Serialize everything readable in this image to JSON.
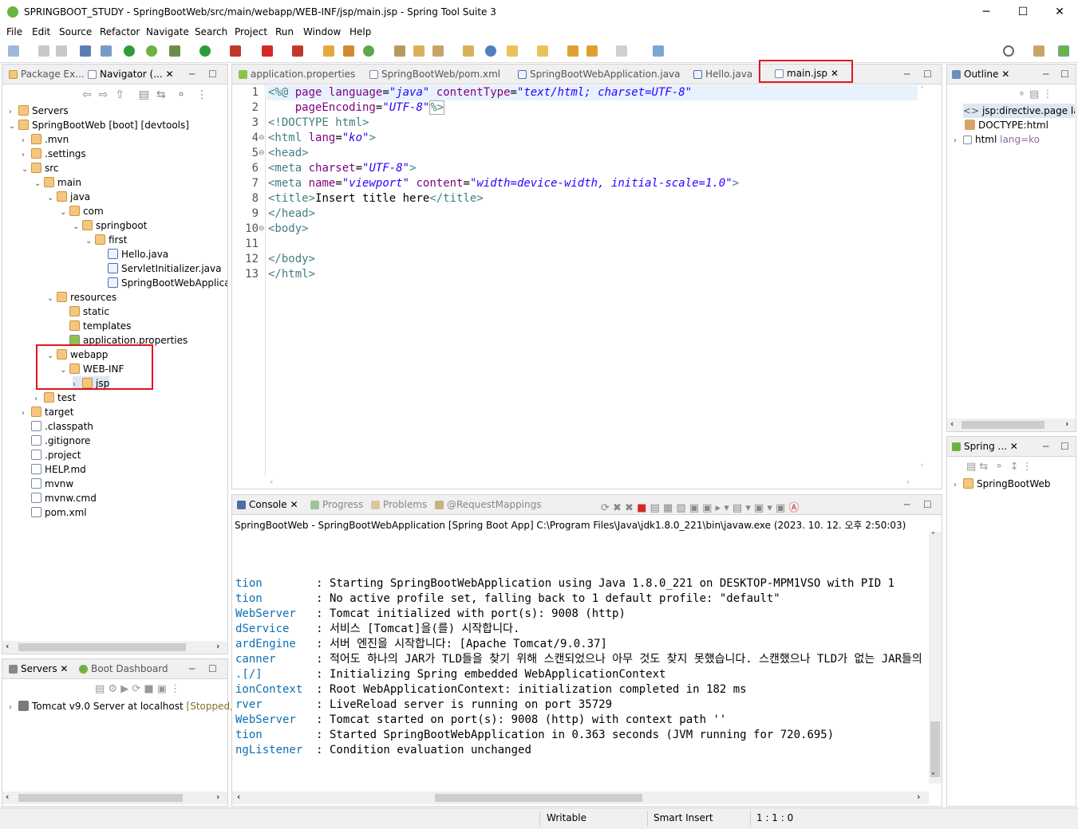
{
  "window": {
    "title": "SPRINGBOOT_STUDY - SpringBootWeb/src/main/webapp/WEB-INF/jsp/main.jsp - Spring Tool Suite 3"
  },
  "menu": [
    "File",
    "Edit",
    "Source",
    "Refactor",
    "Navigate",
    "Search",
    "Project",
    "Run",
    "Window",
    "Help"
  ],
  "left_panel": {
    "tabs": [
      "Package Ex...",
      "Navigator (..."
    ],
    "tree": [
      {
        "label": "Servers",
        "depth": 0,
        "arrow": "›",
        "icon": "folder"
      },
      {
        "label": "SpringBootWeb [boot] [devtools]",
        "depth": 0,
        "arrow": "⌄",
        "icon": "project"
      },
      {
        "label": ".mvn",
        "depth": 1,
        "arrow": "›",
        "icon": "folder"
      },
      {
        "label": ".settings",
        "depth": 1,
        "arrow": "›",
        "icon": "folder"
      },
      {
        "label": "src",
        "depth": 1,
        "arrow": "⌄",
        "icon": "folder"
      },
      {
        "label": "main",
        "depth": 2,
        "arrow": "⌄",
        "icon": "folder"
      },
      {
        "label": "java",
        "depth": 3,
        "arrow": "⌄",
        "icon": "folder"
      },
      {
        "label": "com",
        "depth": 4,
        "arrow": "⌄",
        "icon": "folder"
      },
      {
        "label": "springboot",
        "depth": 5,
        "arrow": "⌄",
        "icon": "folder"
      },
      {
        "label": "first",
        "depth": 6,
        "arrow": "⌄",
        "icon": "folder"
      },
      {
        "label": "Hello.java",
        "depth": 7,
        "arrow": "",
        "icon": "java"
      },
      {
        "label": "ServletInitializer.java",
        "depth": 7,
        "arrow": "",
        "icon": "java"
      },
      {
        "label": "SpringBootWebApplicat",
        "depth": 7,
        "arrow": "",
        "icon": "java"
      },
      {
        "label": "resources",
        "depth": 3,
        "arrow": "⌄",
        "icon": "folder"
      },
      {
        "label": "static",
        "depth": 4,
        "arrow": "",
        "icon": "folder"
      },
      {
        "label": "templates",
        "depth": 4,
        "arrow": "",
        "icon": "folder"
      },
      {
        "label": "application.properties",
        "depth": 4,
        "arrow": "",
        "icon": "props"
      },
      {
        "label": "webapp",
        "depth": 3,
        "arrow": "⌄",
        "icon": "folder"
      },
      {
        "label": "WEB-INF",
        "depth": 4,
        "arrow": "⌄",
        "icon": "folder"
      },
      {
        "label": "jsp",
        "depth": 5,
        "arrow": "›",
        "icon": "folder"
      },
      {
        "label": "test",
        "depth": 2,
        "arrow": "›",
        "icon": "folder"
      },
      {
        "label": "target",
        "depth": 1,
        "arrow": "›",
        "icon": "folder"
      },
      {
        "label": ".classpath",
        "depth": 1,
        "arrow": "",
        "icon": "file"
      },
      {
        "label": ".gitignore",
        "depth": 1,
        "arrow": "",
        "icon": "file"
      },
      {
        "label": ".project",
        "depth": 1,
        "arrow": "",
        "icon": "file"
      },
      {
        "label": "HELP.md",
        "depth": 1,
        "arrow": "",
        "icon": "file"
      },
      {
        "label": "mvnw",
        "depth": 1,
        "arrow": "",
        "icon": "file"
      },
      {
        "label": "mvnw.cmd",
        "depth": 1,
        "arrow": "",
        "icon": "file"
      },
      {
        "label": "pom.xml",
        "depth": 1,
        "arrow": "",
        "icon": "file"
      }
    ]
  },
  "servers_panel": {
    "tabs": [
      "Servers",
      "Boot Dashboard"
    ],
    "server": "Tomcat v9.0 Server at localhost",
    "status": "[Stopped, F"
  },
  "editor": {
    "tabs": [
      "application.properties",
      "SpringBootWeb/pom.xml",
      "SpringBootWebApplication.java",
      "Hello.java",
      "main.jsp"
    ],
    "line_numbers": [
      "1",
      "2",
      "3",
      "4",
      "5",
      "6",
      "7",
      "8",
      "9",
      "10",
      "11",
      "12",
      "13"
    ]
  },
  "console": {
    "tabs": [
      "Console",
      "Progress",
      "Problems",
      "@RequestMappings"
    ],
    "header": "SpringBootWeb - SpringBootWebApplication [Spring Boot App] C:\\Program Files\\Java\\jdk1.8.0_221\\bin\\javaw.exe  (2023. 10. 12. 오후 2:50:03)",
    "lines": [
      {
        "logger": "tion       ",
        "msg": " : Starting SpringBootWebApplication using Java 1.8.0_221 on DESKTOP-MPM1VSO with PID 1"
      },
      {
        "logger": "tion       ",
        "msg": " : No active profile set, falling back to 1 default profile: \"default\""
      },
      {
        "logger": "WebServer  ",
        "msg": " : Tomcat initialized with port(s): 9008 (http)"
      },
      {
        "logger": "dService   ",
        "msg": " : 서비스 [Tomcat]을(를) 시작합니다."
      },
      {
        "logger": "ardEngine  ",
        "msg": " : 서버 엔진을 시작합니다: [Apache Tomcat/9.0.37]"
      },
      {
        "logger": "canner     ",
        "msg": " : 적어도 하나의 JAR가 TLD들을 찾기 위해 스캔되었으나 아무 것도 찾지 못했습니다. 스캔했으나 TLD가 없는 JAR들의 전체 목록을 보시"
      },
      {
        "logger": ".[/]       ",
        "msg": " : Initializing Spring embedded WebApplicationContext"
      },
      {
        "logger": "ionContext ",
        "msg": " : Root WebApplicationContext: initialization completed in 182 ms"
      },
      {
        "logger": "rver       ",
        "msg": " : LiveReload server is running on port 35729"
      },
      {
        "logger": "WebServer  ",
        "msg": " : Tomcat started on port(s): 9008 (http) with context path ''"
      },
      {
        "logger": "tion       ",
        "msg": " : Started SpringBootWebApplication in 0.363 seconds (JVM running for 720.695)"
      },
      {
        "logger": "ngListener ",
        "msg": " : Condition evaluation unchanged"
      }
    ]
  },
  "outline": {
    "tab": "Outline",
    "items": [
      {
        "label": "jsp:directive.page lang",
        "extra": ""
      },
      {
        "label": "DOCTYPE:html",
        "extra": ""
      },
      {
        "label": "html",
        "extra": " lang=ko"
      }
    ]
  },
  "spring_panel": {
    "tab": "Spring ...",
    "item": "SpringBootWeb"
  },
  "status": {
    "writable": "Writable",
    "insert": "Smart Insert",
    "pos": "1 : 1 : 0"
  }
}
